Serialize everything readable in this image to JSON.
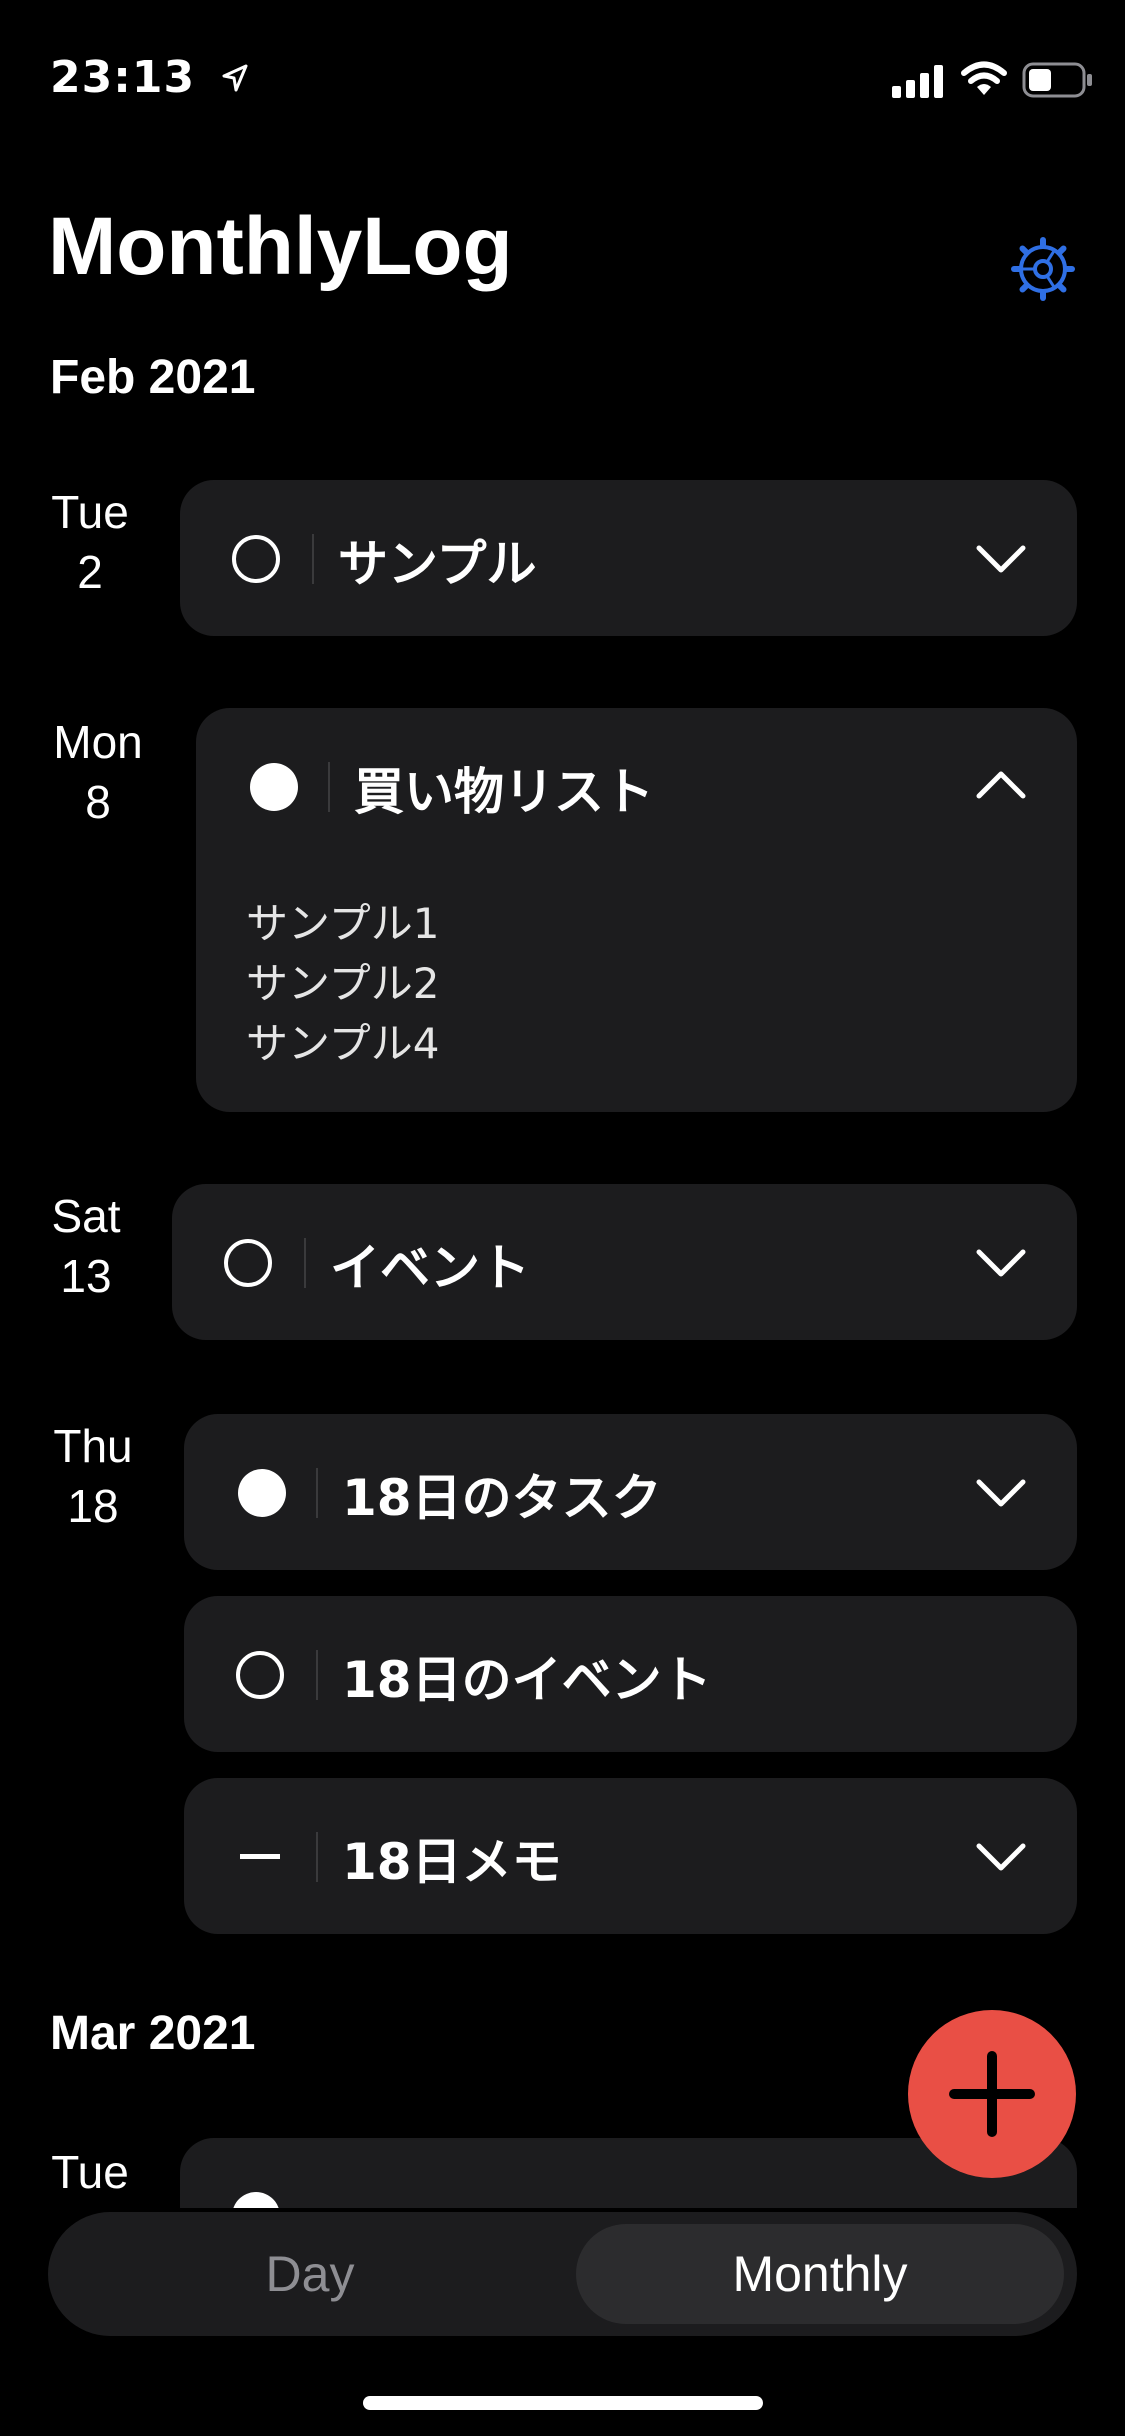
{
  "status": {
    "time": "23:13"
  },
  "header": {
    "title": "MonthlyLog"
  },
  "sections": [
    {
      "month": "Feb 2021"
    },
    {
      "month": "Mar 2021"
    }
  ],
  "days": [
    {
      "weekday": "Tue",
      "date": "2"
    },
    {
      "weekday": "Mon",
      "date": "8"
    },
    {
      "weekday": "Sat",
      "date": "13"
    },
    {
      "weekday": "Thu",
      "date": "18"
    },
    {
      "weekday": "Tue",
      "date": ""
    }
  ],
  "entries": [
    {
      "title": "サンプル",
      "bullet": "open",
      "expanded": false
    },
    {
      "title": "買い物リスト",
      "bullet": "filled",
      "expanded": true,
      "items": [
        "サンプル1",
        "サンプル2",
        "サンプル4"
      ]
    },
    {
      "title": "イベント",
      "bullet": "open",
      "expanded": false
    },
    {
      "title": "18日のタスク",
      "bullet": "filled",
      "expanded": false
    },
    {
      "title": "18日のイベント",
      "bullet": "open",
      "expanded": false
    },
    {
      "title": "18日メモ",
      "bullet": "dash",
      "expanded": false
    }
  ],
  "tabs": {
    "day": "Day",
    "monthly": "Monthly",
    "selected": "Monthly"
  },
  "colors": {
    "accent": "#2f6fe4",
    "fab": "#e94f45",
    "card": "#1c1c1e"
  }
}
